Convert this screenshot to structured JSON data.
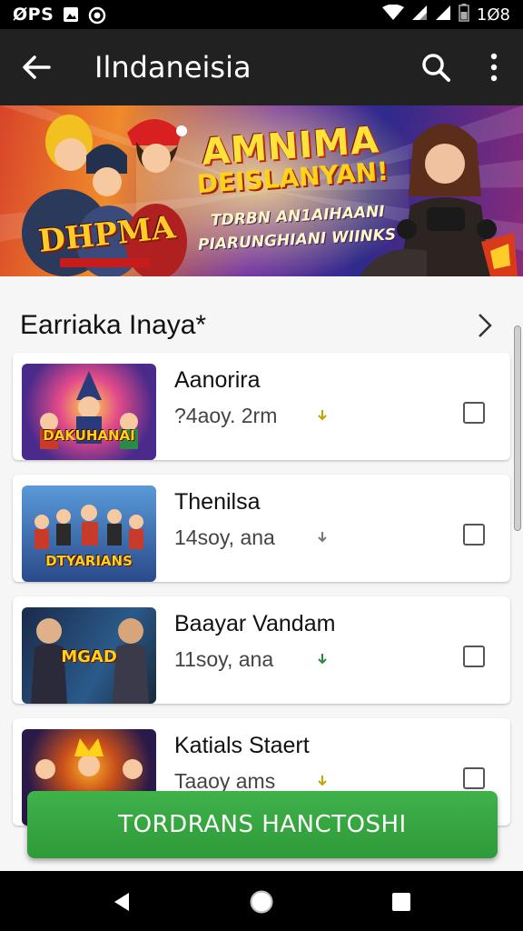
{
  "status_bar": {
    "carrier": "ØPS",
    "time": "1Ø8",
    "icons": [
      "image-icon",
      "record-icon",
      "wifi-icon",
      "signal-icon",
      "signal-icon",
      "battery-icon"
    ]
  },
  "app_bar": {
    "title": "Ilndaneisia",
    "back_icon": "arrow-back-icon",
    "search_icon": "search-icon",
    "menu_icon": "more-vert-icon"
  },
  "banner": {
    "headline_line1": "AMNIMA",
    "headline_line2": "DEISLANYAN!",
    "subline1": "TDRBN AN1AIHAANI",
    "subline2": "PIARUNGHIANI WIINKS",
    "logo_text": "DHPMA"
  },
  "section": {
    "title": "Earriaka Inaya*",
    "chevron_icon": "chevron-right-icon"
  },
  "items": [
    {
      "name": "Aanorira",
      "meta": "?4aoy. 2rm",
      "thumb_text": "DAKUHANAI",
      "dl_color": "#c9a200"
    },
    {
      "name": "Thenilsa",
      "meta": "14soy, ana",
      "thumb_text": "DTYARIANS",
      "dl_color": "#777777"
    },
    {
      "name": "Baayar Vandam",
      "meta": "11soy, ana",
      "thumb_text": "MGAD",
      "dl_color": "#2a8a3a"
    },
    {
      "name": "Katials Staert",
      "meta": "Taaoy ams",
      "thumb_text": "",
      "dl_color": "#c9a200"
    }
  ],
  "cta": {
    "label": "TORDRANS HANCTOSHI"
  },
  "nav": {
    "back": "nav-back-icon",
    "home": "nav-home-icon",
    "recents": "nav-recents-icon"
  },
  "colors": {
    "app_bar": "#212121",
    "cta": "#35a841",
    "status_bar": "#000000"
  }
}
